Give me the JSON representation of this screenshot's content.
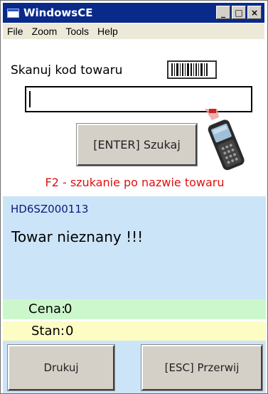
{
  "window": {
    "title": "WindowsCE",
    "minimize_label": "_",
    "maximize_label": "□",
    "close_label": "×"
  },
  "menu": {
    "items": [
      "File",
      "Zoom",
      "Tools",
      "Help"
    ]
  },
  "scan": {
    "label": "Skanuj kod towaru",
    "barcode_icon": "barcode-icon",
    "input_value": ""
  },
  "search": {
    "button_label": "[ENTER] Szukaj",
    "scanner_icon": "handheld-scanner-icon",
    "hint": "F2 - szukanie po nazwie towaru"
  },
  "product": {
    "code": "HD6SZ000113",
    "status": "Towar nieznany !!!"
  },
  "fields": {
    "cena_label": "Cena:",
    "cena_value": "0",
    "stan_label": "Stan:",
    "stan_value": "0"
  },
  "actions": {
    "print_label": "Drukuj",
    "cancel_label": "[ESC] Przerwij"
  },
  "colors": {
    "titlebar": "#0a2a8a",
    "hint_red": "#e01010",
    "product_code_blue": "#0a1a7a",
    "panel_blue": "#cce4f7",
    "cena_green": "#ccf7cc",
    "stan_yellow": "#fcfcc4"
  }
}
